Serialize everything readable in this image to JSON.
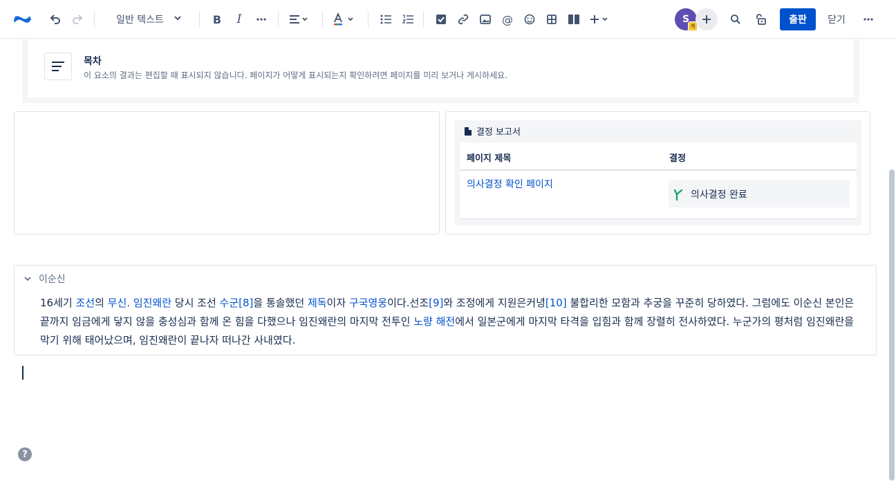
{
  "toolbar": {
    "text_style": "일반 텍스트",
    "avatar_initial": "S",
    "avatar_badge": "게",
    "publish_label": "출판",
    "close_label": "닫기"
  },
  "toc": {
    "title": "목차",
    "description": "이 요소의 결과는 편집할 때 표시되지 않습니다. 페이지가 어떻게 표시되는지 확인하려면 페이지를 미리 보거나 게시하세요."
  },
  "report": {
    "title": "결정 보고서",
    "col_page_title": "페이지 제목",
    "col_decision": "결정",
    "page_link": "의사결정 확인 페이지",
    "decision_status": "의사결정 완료"
  },
  "expand": {
    "title": "이순신",
    "body": [
      {
        "t": "16세기 ",
        "link": false
      },
      {
        "t": "조선",
        "link": true
      },
      {
        "t": "의 ",
        "link": false
      },
      {
        "t": "무신",
        "link": true
      },
      {
        "t": ". ",
        "link": false
      },
      {
        "t": "임진왜란",
        "link": true
      },
      {
        "t": " 당시 조선 ",
        "link": false
      },
      {
        "t": "수군",
        "link": true
      },
      {
        "t": "[8]",
        "link": true
      },
      {
        "t": "을 통솔했던 ",
        "link": false
      },
      {
        "t": "제독",
        "link": true
      },
      {
        "t": "이자 ",
        "link": false
      },
      {
        "t": "구국영웅",
        "link": true
      },
      {
        "t": "이다.선조",
        "link": false
      },
      {
        "t": "[9]",
        "link": true
      },
      {
        "t": "와 조정에게 지원은커녕",
        "link": false
      },
      {
        "t": "[10]",
        "link": true
      },
      {
        "t": " 불합리한 모함과 추궁을 꾸준히 당하였다. 그럼에도 이순신 본인은 끝까지 임금에게 닿지 않을 충성심과 함께 온 힘을 다했으나 임진왜란의 마지막 전투인 ",
        "link": false
      },
      {
        "t": "노량 해전",
        "link": true
      },
      {
        "t": "에서 일본군에게 마지막 타격을 입힘과 함께 장렬히 전사하였다. 누군가의 평처럼 임진왜란을 막기 위해 태어났으며, 임진왜란이 끝나자 떠나간 사내였다.",
        "link": false
      }
    ]
  },
  "help_label": "?"
}
